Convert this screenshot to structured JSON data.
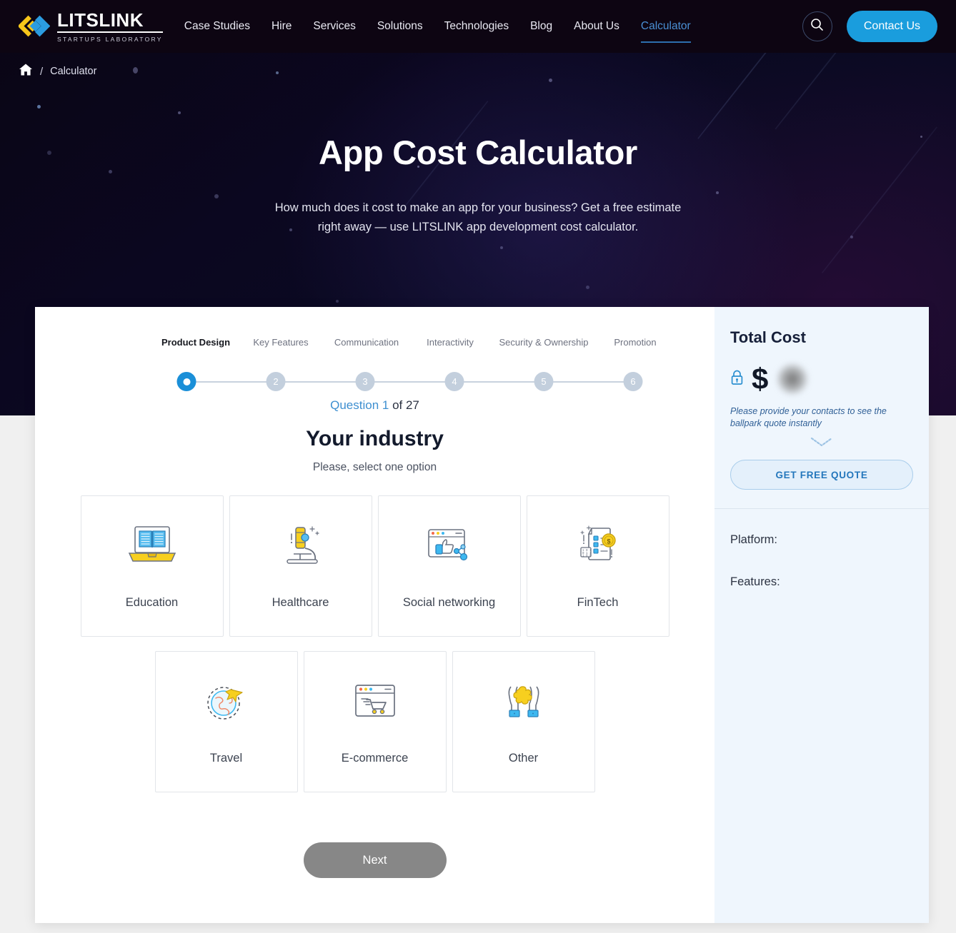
{
  "brand": {
    "name": "LITSLINK",
    "tagline": "STARTUPS LABORATORY",
    "logo_icon": "litslink-diamond-logo",
    "accent_blue": "#1a9ddd",
    "accent_yellow": "#f5c518"
  },
  "nav": {
    "links": [
      {
        "label": "Case Studies",
        "active": false
      },
      {
        "label": "Hire",
        "active": false
      },
      {
        "label": "Services",
        "active": false
      },
      {
        "label": "Solutions",
        "active": false
      },
      {
        "label": "Technologies",
        "active": false
      },
      {
        "label": "Blog",
        "active": false
      },
      {
        "label": "About Us",
        "active": false
      },
      {
        "label": "Calculator",
        "active": true
      }
    ],
    "search_icon": "search-icon",
    "contact_label": "Contact Us"
  },
  "breadcrumb": {
    "home_icon": "home-icon",
    "separator": "/",
    "current": "Calculator"
  },
  "hero": {
    "title": "App Cost Calculator",
    "subtitle": "How much does it cost to make an app for your business? Get a free estimate right away — use LITSLINK app development cost calculator."
  },
  "stepper": {
    "steps": [
      {
        "label": "Product Design",
        "number": "1",
        "active": true
      },
      {
        "label": "Key Features",
        "number": "2",
        "active": false
      },
      {
        "label": "Communication",
        "number": "3",
        "active": false
      },
      {
        "label": "Interactivity",
        "number": "4",
        "active": false
      },
      {
        "label": "Security & Ownership",
        "number": "5",
        "active": false
      },
      {
        "label": "Promotion",
        "number": "6",
        "active": false
      }
    ]
  },
  "question": {
    "counter_prefix": "Question 1",
    "counter_suffix": " of 27",
    "title": "Your industry",
    "hint": "Please, select one option",
    "options_row1": [
      {
        "label": "Education",
        "icon": "laptop-book-icon"
      },
      {
        "label": "Healthcare",
        "icon": "microscope-icon"
      },
      {
        "label": "Social networking",
        "icon": "browser-thumbs-up-icon"
      },
      {
        "label": "FinTech",
        "icon": "invoice-coin-icon"
      }
    ],
    "options_row2": [
      {
        "label": "Travel",
        "icon": "globe-airplane-icon"
      },
      {
        "label": "E-commerce",
        "icon": "browser-cart-icon"
      },
      {
        "label": "Other",
        "icon": "hands-puzzle-icon"
      }
    ],
    "next_label": "Next"
  },
  "sidebar": {
    "title": "Total Cost",
    "lock_icon": "lock-icon",
    "currency_symbol": "$",
    "value_hidden": true,
    "note": "Please provide your contacts to see the ballpark quote instantly",
    "chevron_icon": "chevron-down-dotted-icon",
    "quote_button": "GET FREE QUOTE",
    "fields": [
      {
        "label": "Platform:",
        "value": ""
      },
      {
        "label": "Features:",
        "value": ""
      }
    ]
  }
}
